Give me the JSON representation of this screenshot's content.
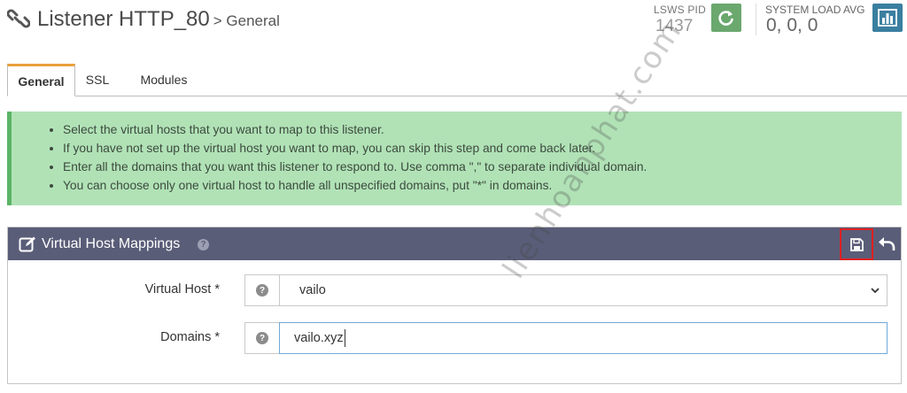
{
  "header": {
    "title": "Listener HTTP_80",
    "breadcrumb": "> General",
    "pid_label": "LSWS PID",
    "pid_value": "1437",
    "load_label": "SYSTEM LOAD AVG",
    "load_value": "0, 0, 0",
    "icons": {
      "logo": "link-chain-icon",
      "restart": "restart-icon",
      "stats": "bar-chart-icon"
    },
    "colors": {
      "restart_btn": "#6aa86e",
      "stats_btn": "#3a7fa0"
    }
  },
  "tabs": [
    {
      "label": "General",
      "active": true
    },
    {
      "label": "SSL",
      "active": false
    },
    {
      "label": "Modules",
      "active": false
    }
  ],
  "info": {
    "items": [
      "Select the virtual hosts that you want to map to this listener.",
      "If you have not set up the virtual host you want to map, you can skip this step and come back later.",
      "Enter all the domains that you want this listener to respond to. Use comma \",\" to separate individual domain.",
      "You can choose only one virtual host to handle all unspecified domains, put \"*\" in domains."
    ]
  },
  "panel": {
    "title": "Virtual Host Mappings",
    "help_glyph": "?",
    "icons": {
      "edit": "edit-icon",
      "save": "save-icon",
      "undo": "undo-icon",
      "help": "help-icon"
    },
    "fields": {
      "vhost_label": "Virtual Host *",
      "vhost_value": "vailo",
      "domains_label": "Domains *",
      "domains_value": "vailo.xyz"
    }
  },
  "watermark": "lienhoanphat.com"
}
